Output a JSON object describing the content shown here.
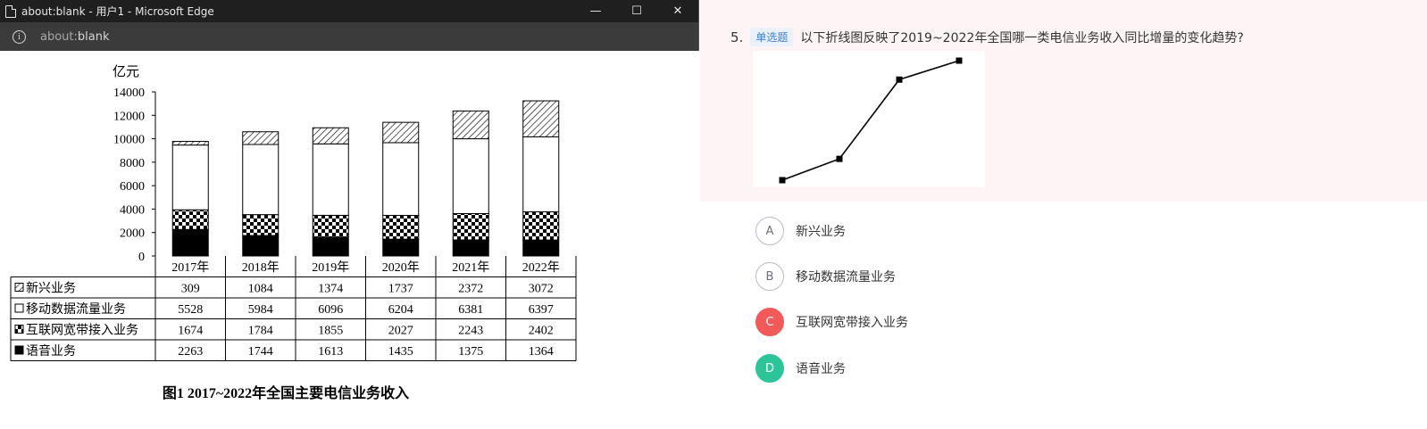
{
  "window": {
    "title": "about:blank - 用户1 - Microsoft Edge",
    "url_prefix": "about:",
    "url_rest": "blank",
    "minimize_glyph": "—",
    "maximize_glyph": "☐",
    "close_glyph": "✕",
    "info_glyph": "i"
  },
  "chart_data": {
    "type": "bar",
    "stacked": true,
    "unit_label": "亿元",
    "categories": [
      "2017年",
      "2018年",
      "2019年",
      "2020年",
      "2021年",
      "2022年"
    ],
    "series": [
      {
        "name": "新兴业务",
        "values": [
          309,
          1084,
          1374,
          1737,
          2372,
          3072
        ],
        "pattern": "diagonal-hatch"
      },
      {
        "name": "移动数据流量业务",
        "values": [
          5528,
          5984,
          6096,
          6204,
          6381,
          6397
        ],
        "pattern": "white"
      },
      {
        "name": "互联网宽带接入业务",
        "values": [
          1674,
          1784,
          1855,
          2027,
          2243,
          2402
        ],
        "pattern": "checker"
      },
      {
        "name": "语音业务",
        "values": [
          2263,
          1744,
          1613,
          1435,
          1375,
          1364
        ],
        "pattern": "solid-black"
      }
    ],
    "yticks": [
      0,
      2000,
      4000,
      6000,
      8000,
      10000,
      12000,
      14000
    ],
    "ylim": [
      0,
      14000
    ],
    "title": "图1  2017~2022年全国主要电信业务收入"
  },
  "question": {
    "number": "5.",
    "type_badge": "单选题",
    "text": "以下折线图反映了2019~2022年全国哪一类电信业务收入同比增量的变化趋势?",
    "mini_chart": {
      "type": "line",
      "values": [
        290,
        363,
        635,
        700
      ]
    },
    "options": [
      {
        "letter": "A",
        "label": "新兴业务",
        "state": "normal"
      },
      {
        "letter": "B",
        "label": "移动数据流量业务",
        "state": "normal"
      },
      {
        "letter": "C",
        "label": "互联网宽带接入业务",
        "state": "wrong"
      },
      {
        "letter": "D",
        "label": "语音业务",
        "state": "correct"
      }
    ]
  },
  "colors": {
    "wrong": "#f25a5a",
    "correct": "#2ec49a",
    "badge_text": "#3d7fd0"
  }
}
